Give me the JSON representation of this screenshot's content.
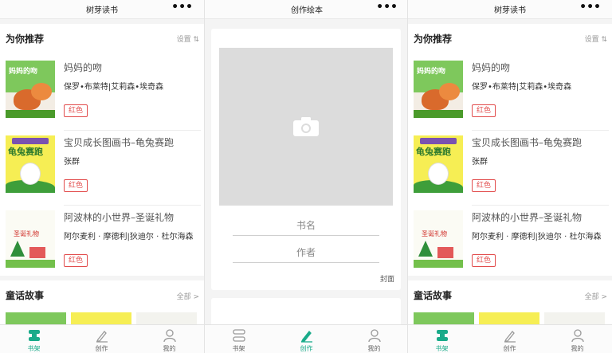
{
  "screens": {
    "bookshelf": {
      "title": "树芽读书",
      "more": "•••",
      "recommend": {
        "title": "为你推荐",
        "settings": "设置 ⇅",
        "books": [
          {
            "title": "妈妈的吻",
            "author": "保罗•布莱特|艾莉森•埃奇森",
            "tag": "红色",
            "cover_text": "妈妈的吻"
          },
          {
            "title": "宝贝成长图画书–龟兔赛跑",
            "author": "张群",
            "tag": "红色",
            "cover_text": "龟兔赛跑"
          },
          {
            "title": "阿波林的小世界–圣诞礼物",
            "author": "阿尔麦利 · 摩德利|狄迪尔 · 杜尔海森",
            "tag": "红色",
            "cover_text": "圣诞礼物"
          }
        ]
      },
      "tales": {
        "title": "童话故事",
        "all": "全部 >"
      }
    },
    "create": {
      "title": "创作绘本",
      "more": "•••",
      "book_name_placeholder": "书名",
      "author_placeholder": "作者",
      "cover_label": "封面"
    }
  },
  "tabbar": {
    "bookshelf": "书架",
    "create": "创作",
    "mine": "我的",
    "active_color": "#1aab8a",
    "inactive_color": "#999999"
  },
  "colors": {
    "tag_red": "#e24c4c",
    "accent": "#1aab8a"
  }
}
